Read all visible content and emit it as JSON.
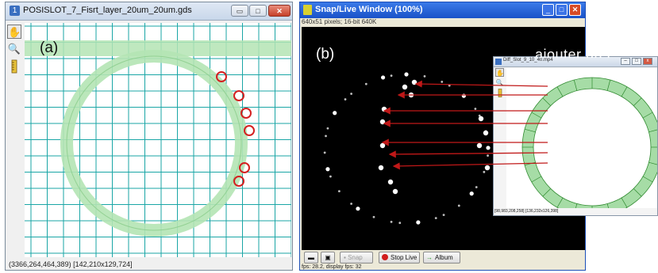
{
  "left_window": {
    "title_icon": "1",
    "title": "POSISLOT_7_Fisrt_layer_20um_20um.gds",
    "buttons": {
      "minimize": "▭",
      "maximize": "□",
      "close": "✕"
    },
    "tools": [
      "hand-icon",
      "magnifier-icon",
      "ruler-icon"
    ],
    "status": "(3366,264,464,389)  [142,210x129,724]",
    "colors": {
      "grid": "#1aa6a6",
      "ring_fill": "#b4e4b4",
      "marker": "#d42020"
    }
  },
  "right_window": {
    "title": "Snap/Live Window (100%)",
    "info": "640x51 pixels; 16-bit 640K",
    "buttons": {
      "snap": "Snap",
      "stop_live": "Stop Live",
      "album": "Album"
    },
    "fps": "fps: 28.2, display fps: 32",
    "colors": {
      "arrow": "#c01818",
      "background": "#000000"
    }
  },
  "inset_window": {
    "title": "Diff_Slot_9_10_40.mp4",
    "background_text": "ajouter un t",
    "status": "[98,983,208,258]  [136,232x126,398]",
    "colors": {
      "ring_fill": "#a6dca6",
      "ring_line": "#2f8a2f"
    }
  },
  "labels": {
    "a": "(a)",
    "b": "(b)"
  }
}
